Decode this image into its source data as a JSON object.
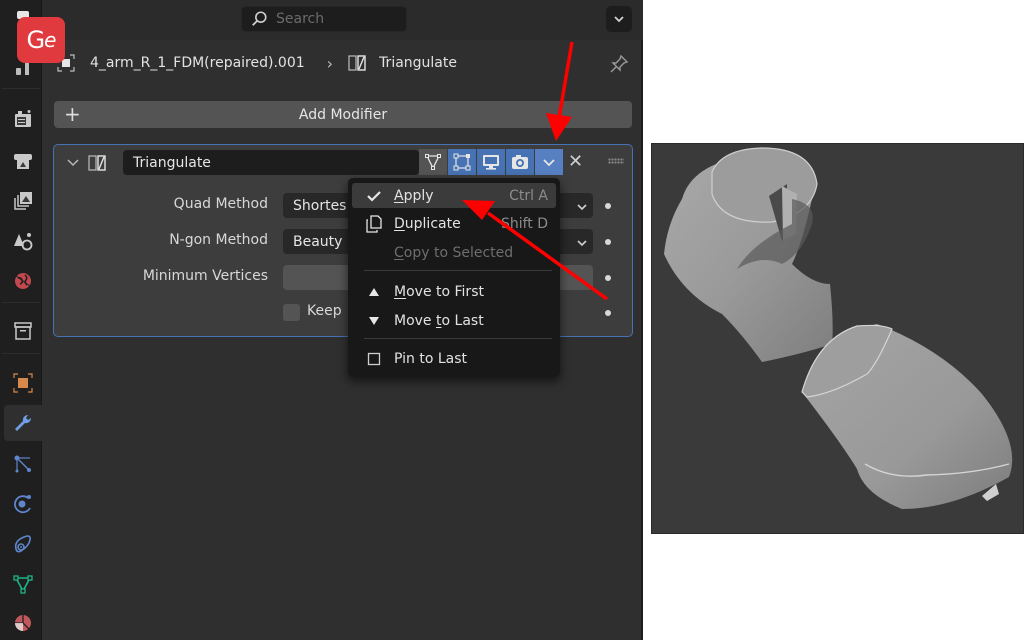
{
  "brand": {
    "logo_text_g": "G",
    "logo_text_e": "e",
    "color": "#e03a3e"
  },
  "topbar": {
    "search_placeholder": "Search"
  },
  "breadcrumb": {
    "object_name": "4_arm_R_1_FDM(repaired).001",
    "modifier_name": "Triangulate"
  },
  "toolbar": {
    "add_modifier_label": "Add Modifier"
  },
  "sidebar": {
    "tabs": [
      {
        "name": "tool",
        "icon": "tool-icon"
      },
      {
        "name": "render",
        "icon": "render-icon"
      },
      {
        "name": "output",
        "icon": "output-icon"
      },
      {
        "name": "view-layer",
        "icon": "view-layer-icon"
      },
      {
        "name": "scene",
        "icon": "scene-icon"
      },
      {
        "name": "world",
        "icon": "world-icon"
      },
      {
        "name": "collection",
        "icon": "collection-icon"
      },
      {
        "name": "object",
        "icon": "object-icon"
      },
      {
        "name": "modifiers",
        "icon": "wrench-icon",
        "active": true
      },
      {
        "name": "particles",
        "icon": "particles-icon"
      },
      {
        "name": "physics",
        "icon": "physics-icon"
      },
      {
        "name": "constraints",
        "icon": "constraints-icon"
      },
      {
        "name": "data",
        "icon": "mesh-data-icon"
      },
      {
        "name": "material",
        "icon": "material-icon"
      }
    ]
  },
  "modifier": {
    "name": "Triangulate",
    "fields": [
      {
        "label": "Quad Method",
        "value": "Shortest Diagonal",
        "visible_value": "Shortes"
      },
      {
        "label": "N-gon Method",
        "value": "Beauty"
      },
      {
        "label": "Minimum Vertices",
        "value": ""
      }
    ],
    "checkbox": {
      "label": "Keep",
      "checked": false
    }
  },
  "context_menu": {
    "items": [
      {
        "label": "Apply",
        "underline": "A",
        "rest": "pply",
        "shortcut": "Ctrl A",
        "icon": "checkmark-icon",
        "highlighted": true
      },
      {
        "label": "Duplicate",
        "underline": "D",
        "rest": "uplicate",
        "shortcut": "Shift D",
        "icon": "duplicate-icon"
      },
      {
        "label": "Copy to Selected",
        "underline": "C",
        "rest": "opy to Selected",
        "disabled": true
      },
      {
        "label": "Move to First",
        "underline": "M",
        "rest": "ove to First",
        "icon": "triangle-up-icon"
      },
      {
        "label": "Move to Last",
        "pre": "Move ",
        "underline": "t",
        "rest": "o Last",
        "icon": "triangle-down-icon"
      },
      {
        "label": "Pin to Last",
        "icon": "checkbox-icon"
      }
    ]
  },
  "annotation": {
    "arrow_color": "#ff0000"
  }
}
